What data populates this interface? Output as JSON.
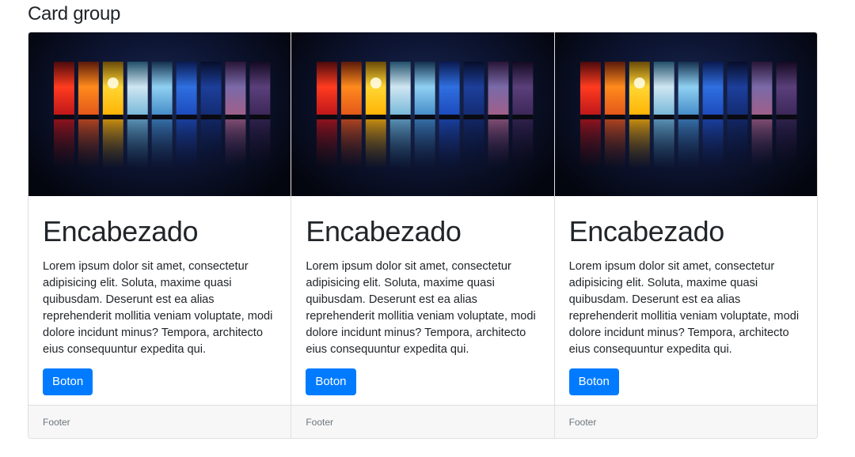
{
  "section": {
    "title": "Card group"
  },
  "cards": [
    {
      "image": "color-spectrum-landscape-image",
      "title": "Encabezado",
      "text": "Lorem ipsum dolor sit amet, consectetur adipisicing elit. Soluta, maxime quasi quibusdam. Deserunt est ea alias reprehenderit mollitia veniam voluptate, modi dolore incidunt minus? Tempora, architecto eius consequuntur expedita qui.",
      "button_label": "Boton",
      "footer": "Footer"
    },
    {
      "image": "color-spectrum-landscape-image",
      "title": "Encabezado",
      "text": "Lorem ipsum dolor sit amet, consectetur adipisicing elit. Soluta, maxime quasi quibusdam. Deserunt est ea alias reprehenderit mollitia veniam voluptate, modi dolore incidunt minus? Tempora, architecto eius consequuntur expedita qui.",
      "button_label": "Boton",
      "footer": "Footer"
    },
    {
      "image": "color-spectrum-landscape-image",
      "title": "Encabezado",
      "text": "Lorem ipsum dolor sit amet, consectetur adipisicing elit. Soluta, maxime quasi quibusdam. Deserunt est ea alias reprehenderit mollitia veniam voluptate, modi dolore incidunt minus? Tempora, architecto eius consequuntur expedita qui.",
      "button_label": "Boton",
      "footer": "Footer"
    }
  ],
  "colors": {
    "primary_button": "#007bff",
    "footer_background": "#f7f7f7",
    "border": "#dfdfdf",
    "text": "#212529",
    "muted_text": "#6c757d"
  }
}
